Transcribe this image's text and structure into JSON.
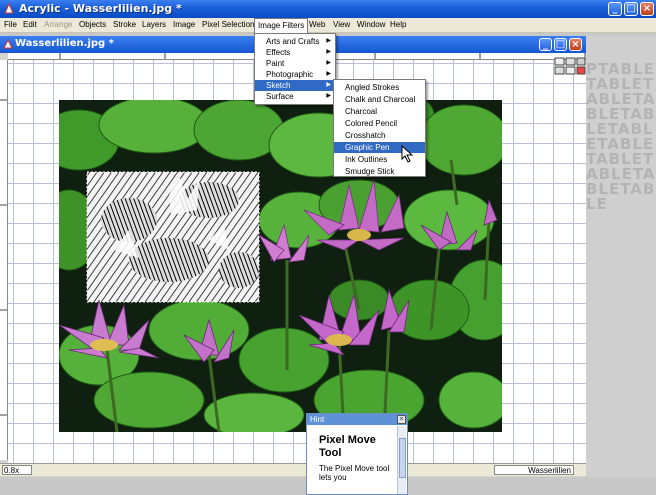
{
  "app": {
    "title": "Acrylic - Wasserlilien.jpg *"
  },
  "menubar": {
    "items": [
      "File",
      "Edit",
      "Arrange",
      "Objects",
      "Stroke",
      "Layers",
      "Image",
      "Pixel Selection",
      "Image Filters",
      "Web",
      "View",
      "Window",
      "Help"
    ],
    "disabled_item": "Arrange",
    "active_item": "Image Filters"
  },
  "document": {
    "title": "Wasserlilien.jpg *",
    "zoom": "0.8x",
    "status_name": "Wasserlilien"
  },
  "image_filters_menu": {
    "items": [
      "Arts and Crafts",
      "Effects",
      "Paint",
      "Photographic",
      "Sketch",
      "Surface"
    ],
    "selected": "Sketch"
  },
  "sketch_submenu": {
    "items": [
      "Angled Strokes",
      "Chalk and Charcoal",
      "Charcoal",
      "Colored Pencil",
      "Crosshatch",
      "Graphic Pen",
      "Ink Outlines",
      "Smudge Stick"
    ],
    "selected": "Graphic Pen"
  },
  "hint": {
    "header": "Hint",
    "title": "Pixel Move Tool",
    "text": "The Pixel Move tool lets you"
  },
  "side_panel": {
    "watermark": "PTABLETABLETABLETABLETABLETABLETABLETABLETABLETABLETABLE"
  },
  "colors": {
    "accent": "#316ac5",
    "titlebar": "#0a4bc6"
  }
}
